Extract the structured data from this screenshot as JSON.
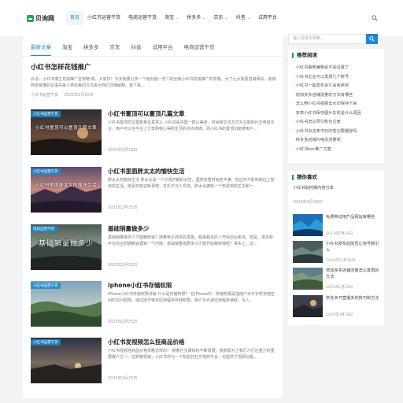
{
  "site": {
    "logo_text": "贝询网"
  },
  "nav": [
    {
      "label": "首页",
      "active": true,
      "caret": false
    },
    {
      "label": "小红书运营干货",
      "active": false,
      "caret": false
    },
    {
      "label": "电商运营干货",
      "active": false,
      "caret": false
    },
    {
      "label": "淘宝",
      "active": false,
      "caret": true
    },
    {
      "label": "拼多多",
      "active": false,
      "caret": true
    },
    {
      "label": "京东",
      "active": false,
      "caret": true
    },
    {
      "label": "抖音",
      "active": false,
      "caret": true
    },
    {
      "label": "试用平台",
      "active": false,
      "caret": false
    }
  ],
  "caret_glyph": "⌄",
  "search": {
    "placeholder": "输入关键字搜索..."
  },
  "tabs": [
    "最新文章",
    "淘宝",
    "拼多多",
    "京东",
    "抖音",
    "试用平台",
    "电商运营干货"
  ],
  "featured": {
    "title": "小红书怎样花钱推广",
    "excerpt": "白话：小红书博主花钱推广全攻略 嘿，大家好！今天我要分享一个绝对独一无二的全新小红书花钱推广的攻略。为了让大家更容易明白，我用简单易懂的言语先来人类风格的方式来为你们详细解释。首下来...",
    "category": "小红书运营干货",
    "date": "2025年2月25日"
  },
  "articles": [
    {
      "title": "小红书置顶可以置顶几篇文章",
      "excerpt": "小红书置顶的文章数量及其意义 小红书是中国一款以美容、时尚和生活方式为主题的社交电商平台，用户可以在平台上分享购物心得和生活的点点滴滴。而小红书的置顶功能使用户...",
      "date": "2025年2月25日",
      "tag": "小红书运营干货",
      "caption": "小红书置顶可以置顶几篇文章"
    },
    {
      "title": "小红书里面胖太太的愉快生活",
      "excerpt": "胖太太的愉快生活 胖太太是一个乐观开朗的女性，虽然体重材有些丰满，但这并不影响她过上愉快的生活。她喜欢尝试新事物，并乐于与人交流。胖太太拥有一个热爱她的丈夫和一...",
      "date": "2025年2月25日",
      "tag": "小红书运营干货",
      "caption": "小红书里面胖太太的愉快生活"
    },
    {
      "title": "基础销量做多少",
      "excerpt": "基础销量做多少才能赚到钱？随着电子商务的发展，越来越多的人开始创业卖货。但是，很多新手在创业初期都会遇到一个问题：基础销量需要多少才能开始赚到钱呢？事实上，这...",
      "date": "2025年2月25日",
      "tag": "电商运营干货",
      "caption": "基础销量做多少"
    },
    {
      "title": "iphone小红书存储权限",
      "excerpt": "iPhone小红书存储权限详解 什么是存储权限？ 在iPhone中，存储权限是指用户对于手机存储空间的访问权限。通过授予特定应用程序存储权限，用户允许该应用程序读取、写入...",
      "date": "2025年2月25日",
      "tag": "小红书运营干货",
      "caption": ""
    },
    {
      "title": "小红书发视频怎么挂商品价格",
      "excerpt": "小红书视频挂商品价格攻略怎样的？ 随着社交媒体的不断发展，视频成为了我们人们注重力的重要媒介之一。在购物领域，小红书作为一个知名的社交电商平台，也提供了视频功能...",
      "date": "2025年2月25日",
      "tag": "小红书运营干货",
      "caption": ""
    }
  ],
  "hot": {
    "title": "推荐阅读",
    "items": [
      "小红书最新编辑会不会设置了",
      "小红书企业可以发朋几个账号",
      "小红书一般发布多久会收卖资",
      "增加多多店铺流量的方法有哪些",
      "怎么辨小红书视频去水印保存下来",
      "安卓小红书保存图片失败是什么原因",
      "小红书怎么导引粉丝注册",
      "小红书点击率不好的笔记要删除吗",
      "拼多多店铺为啥没流量呢",
      "小红书koc推广方案"
    ]
  },
  "guess": {
    "title": "猜你喜欢",
    "first_title": "小红书如何做内容分享",
    "first_date": "2024年9月26日",
    "items": [
      {
        "title": "免费带试用产品网站有哪些",
        "date": "2023年7月20日"
      },
      {
        "title": "小红书发布后能否让信号新引入",
        "date": "2024年11月16日"
      },
      {
        "title": "增加多多店铺流量怎么置再的方法",
        "date": "2025年1月20日"
      },
      {
        "title": "拼多多开直播多的技巧和方法",
        "date": "2025年3月18日"
      }
    ]
  },
  "colors": {
    "accent": "#1e88d2",
    "brand": "#2aa35a"
  },
  "icons": {
    "search": "search-icon",
    "logo": "logo-icon"
  }
}
